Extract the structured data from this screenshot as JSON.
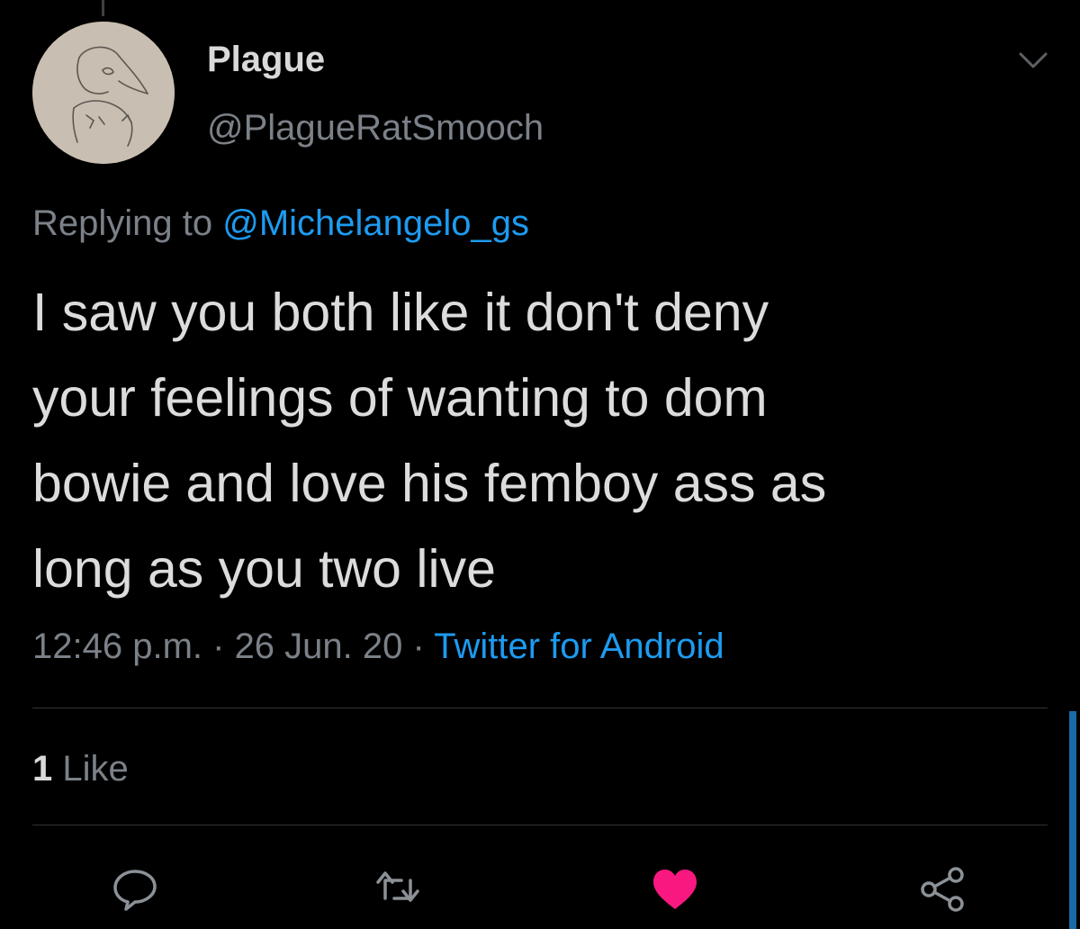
{
  "tweet": {
    "author_name": "Plague",
    "author_handle": "@PlagueRatSmooch",
    "replying_prefix": "Replying to ",
    "replying_to": "@Michelangelo_gs",
    "text_lines": [
      "I saw you both like it don't deny",
      "your feelings of wanting to dom",
      "bowie and love his femboy ass as",
      "long as you two live"
    ],
    "time": "12:46 p.m.",
    "date": "26 Jun. 20",
    "source": "Twitter for Android",
    "separator": " · ",
    "like_count": "1",
    "like_label": " Like"
  },
  "icons": {
    "menu": "chevron-down-icon",
    "reply": "reply-icon",
    "retweet": "retweet-icon",
    "like": "heart-icon",
    "share": "share-icon"
  },
  "colors": {
    "background": "#000000",
    "text": "#d9d9d9",
    "secondary": "#7b8188",
    "link": "#1d9bf0",
    "like": "#f91880",
    "divider": "#2f3336"
  }
}
